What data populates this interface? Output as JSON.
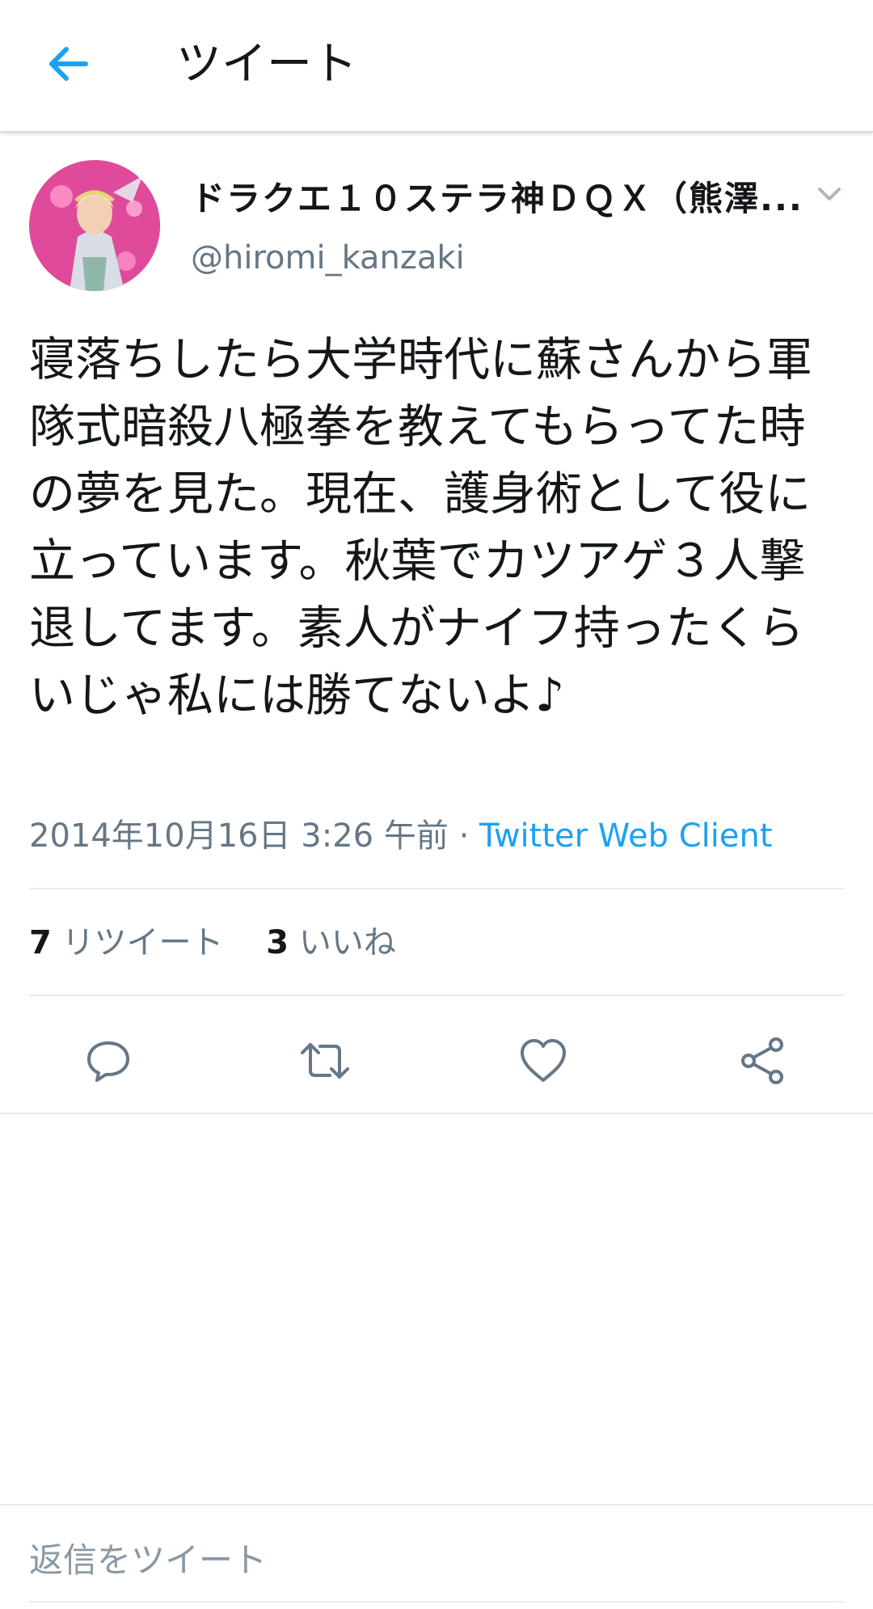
{
  "header": {
    "title": "ツイート",
    "back_icon": "arrow-left-icon",
    "accent_color": "#1da1f2"
  },
  "author": {
    "display_name": "ドラクエ１０ステラ神ＤＱＸ（熊澤...",
    "handle": "@hiromi_kanzaki",
    "caret_icon": "chevron-down-icon"
  },
  "tweet": {
    "text": "寝落ちしたら大学時代に蘇さんから軍隊式暗殺八極拳を教えてもらってた時の夢を見た。現在、護身術として役に立っています。秋葉でカツアゲ３人撃退してます。素人がナイフ持ったくらいじゃ私には勝てないよ♪",
    "timestamp": "2014年10月16日 3:26 午前",
    "separator": "·",
    "client": "Twitter Web Client"
  },
  "stats": {
    "retweets_count": "7",
    "retweets_label": "リツイート",
    "likes_count": "3",
    "likes_label": "いいね"
  },
  "actions": {
    "reply_icon": "reply-icon",
    "retweet_icon": "retweet-icon",
    "like_icon": "heart-icon",
    "share_icon": "share-icon"
  },
  "reply": {
    "placeholder": "返信をツイート"
  }
}
